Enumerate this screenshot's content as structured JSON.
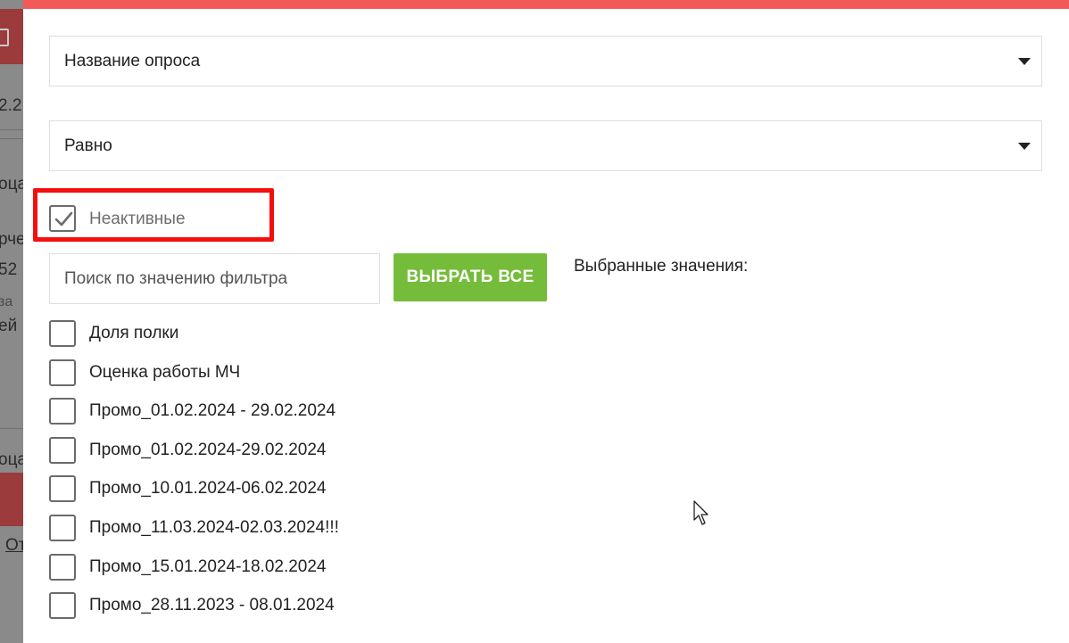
{
  "filter": {
    "field_select": {
      "value": "Название опроса"
    },
    "operator_select": {
      "value": "Равно"
    },
    "inactive": {
      "label": "Неактивные",
      "checked": true
    },
    "search": {
      "placeholder": "Поиск по значению фильтра"
    },
    "select_all_label": "ВЫБРАТЬ ВСЕ",
    "selected_caption": "Выбранные значения:",
    "options": [
      {
        "label": "Доля полки",
        "checked": false
      },
      {
        "label": "Оценка работы МЧ",
        "checked": false
      },
      {
        "label": "Промо_01.02.2024 - 29.02.2024",
        "checked": false
      },
      {
        "label": "Промо_01.02.2024-29.02.2024",
        "checked": false
      },
      {
        "label": "Промо_10.01.2024-06.02.2024",
        "checked": false
      },
      {
        "label": "Промо_11.03.2024-02.03.2024!!!",
        "checked": false
      },
      {
        "label": "Промо_15.01.2024-18.02.2024",
        "checked": false
      },
      {
        "label": "Промо_28.11.2023 - 08.01.2024",
        "checked": false
      }
    ]
  },
  "background": {
    "fragments": [
      "2.2",
      "оца",
      "рче",
      "52",
      "за",
      "ей",
      "оца",
      "От"
    ]
  },
  "colors": {
    "accent_bar": "#f25a5a",
    "highlight_border": "#f40f0f",
    "button_green": "#76bc3b"
  }
}
